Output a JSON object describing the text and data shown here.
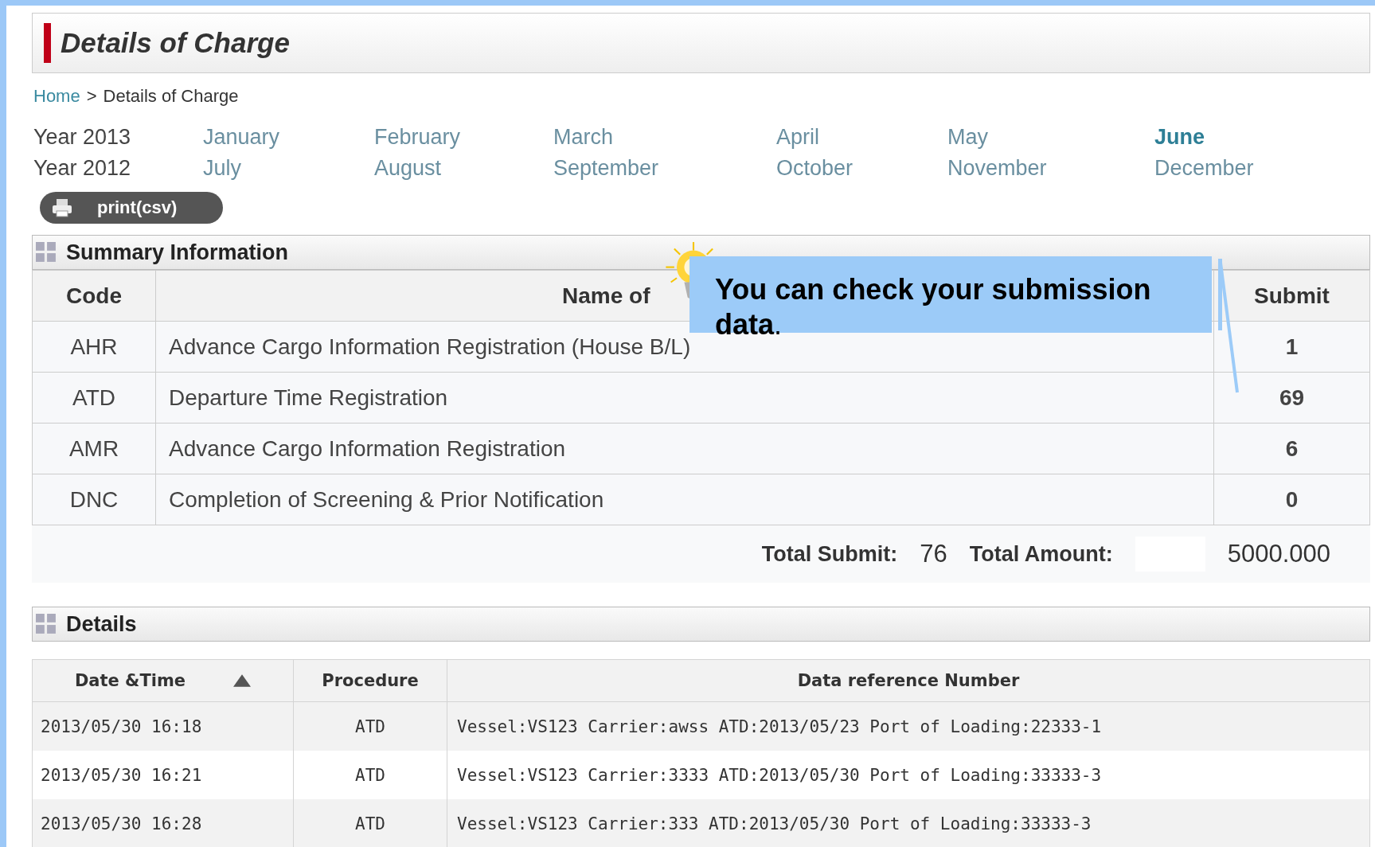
{
  "page_title": "Details of Charge",
  "breadcrumb": {
    "link": "Home",
    "separator": ">",
    "current": "Details of Charge"
  },
  "years": [
    {
      "label": "Year 2013"
    },
    {
      "label": "Year 2012"
    }
  ],
  "months": [
    [
      {
        "label": "January",
        "selected": false
      },
      {
        "label": "February",
        "selected": false
      },
      {
        "label": "March",
        "selected": false
      },
      {
        "label": "April",
        "selected": false
      },
      {
        "label": "May",
        "selected": false
      },
      {
        "label": "June",
        "selected": true
      }
    ],
    [
      {
        "label": "July",
        "selected": false
      },
      {
        "label": "August",
        "selected": false
      },
      {
        "label": "September",
        "selected": false
      },
      {
        "label": "October",
        "selected": false
      },
      {
        "label": "November",
        "selected": false
      },
      {
        "label": "December",
        "selected": false
      }
    ]
  ],
  "print_button": "print(csv)",
  "summary": {
    "title": "Summary Information",
    "columns": [
      "Code",
      "Name of",
      "Submit"
    ],
    "rows": [
      {
        "code": "AHR",
        "name": "Advance Cargo Information Registration (House B/L)",
        "submit": "1"
      },
      {
        "code": "ATD",
        "name": "Departure Time Registration",
        "submit": "69"
      },
      {
        "code": "AMR",
        "name": "Advance Cargo Information Registration",
        "submit": "6"
      },
      {
        "code": "DNC",
        "name": "Completion of Screening & Prior Notification",
        "submit": "0"
      }
    ],
    "total_submit_label": "Total Submit:",
    "total_submit": "76",
    "total_amount_label": "Total Amount:",
    "total_amount": "5000.000"
  },
  "details": {
    "title": "Details",
    "columns": [
      "Date &Time",
      "Procedure",
      "Data reference Number"
    ],
    "rows": [
      {
        "datetime": "2013/05/30 16:18",
        "procedure": "ATD",
        "reference": "Vessel:VS123 Carrier:awss ATD:2013/05/23 Port of Loading:22333-1"
      },
      {
        "datetime": "2013/05/30 16:21",
        "procedure": "ATD",
        "reference": "Vessel:VS123 Carrier:3333 ATD:2013/05/30 Port of Loading:33333-3"
      },
      {
        "datetime": "2013/05/30 16:28",
        "procedure": "ATD",
        "reference": "Vessel:VS123 Carrier:333 ATD:2013/05/30 Port of Loading:33333-3"
      }
    ]
  },
  "callout": {
    "text": "**You can check your submission data**."
  }
}
